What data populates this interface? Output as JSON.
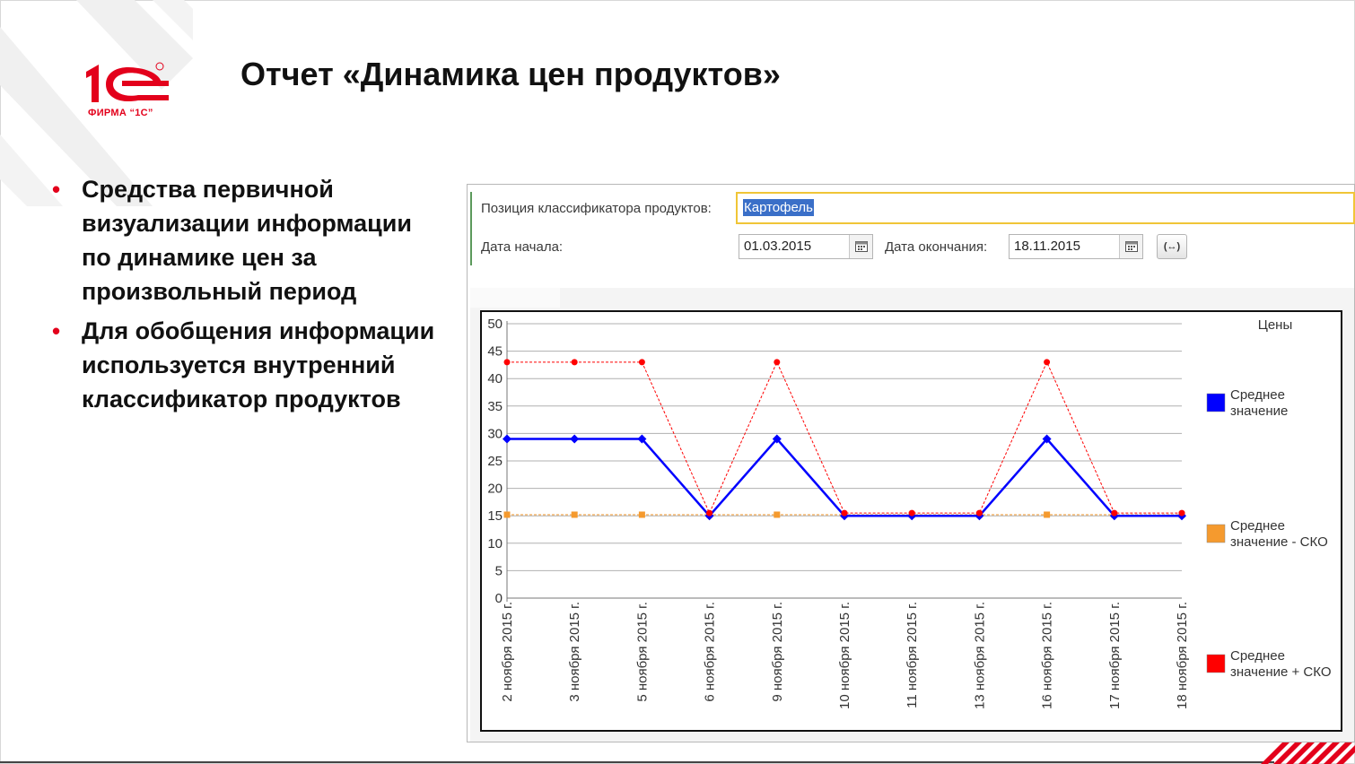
{
  "slide": {
    "title": "Отчет «Динамика цен продуктов»",
    "logo_text": "ФИРМА “1С”",
    "bullets": [
      "Средства первичной визуализации информации по динамике цен за произвольный период",
      "Для обобщения информации используется внутренний классификатор продуктов"
    ]
  },
  "form": {
    "classifier_label": "Позиция классификатора продуктов:",
    "classifier_value": "Картофель",
    "start_label": "Дата начала:",
    "start_value": "01.03.2015",
    "end_label": "Дата окончания:",
    "end_value": "18.11.2015",
    "period_button": "(↔)"
  },
  "colors": {
    "brand_red": "#e3001b",
    "series_mean": "#0000ff",
    "series_minus": "#f59a2e",
    "series_plus": "#ff0000"
  },
  "icons": {
    "calendar": "calendar-icon",
    "period": "period-selector-icon"
  },
  "chart_data": {
    "type": "line",
    "legend_title": "Цены",
    "legend_position": "right",
    "grid": true,
    "ylim": [
      0,
      50
    ],
    "y_ticks": [
      0,
      5,
      10,
      15,
      20,
      25,
      30,
      35,
      40,
      45,
      50
    ],
    "categories": [
      "2 ноября 2015 г.",
      "3 ноября 2015 г.",
      "5 ноября 2015 г.",
      "6 ноября 2015 г.",
      "9 ноября 2015 г.",
      "10 ноября 2015 г.",
      "11 ноября 2015 г.",
      "13 ноября 2015 г.",
      "16 ноября 2015 г.",
      "17 ноября 2015 г.",
      "18 ноября 2015 г."
    ],
    "series": [
      {
        "name": "Среднее значение",
        "color": "#0000ff",
        "marker": "diamond",
        "values": [
          29,
          29,
          29,
          15,
          29,
          15,
          15,
          15,
          29,
          15,
          15
        ]
      },
      {
        "name": "Среднее значение - СКО",
        "color": "#f59a2e",
        "marker": "square",
        "values": [
          15.2,
          15.2,
          15.2,
          15.2,
          15.2,
          15.2,
          15.2,
          15.2,
          15.2,
          15.2,
          15.2
        ]
      },
      {
        "name": "Среднее значение + СКО",
        "color": "#ff0000",
        "marker": "circle",
        "values": [
          43,
          43,
          43,
          15.5,
          43,
          15.5,
          15.5,
          15.5,
          43,
          15.5,
          15.5
        ]
      }
    ]
  }
}
